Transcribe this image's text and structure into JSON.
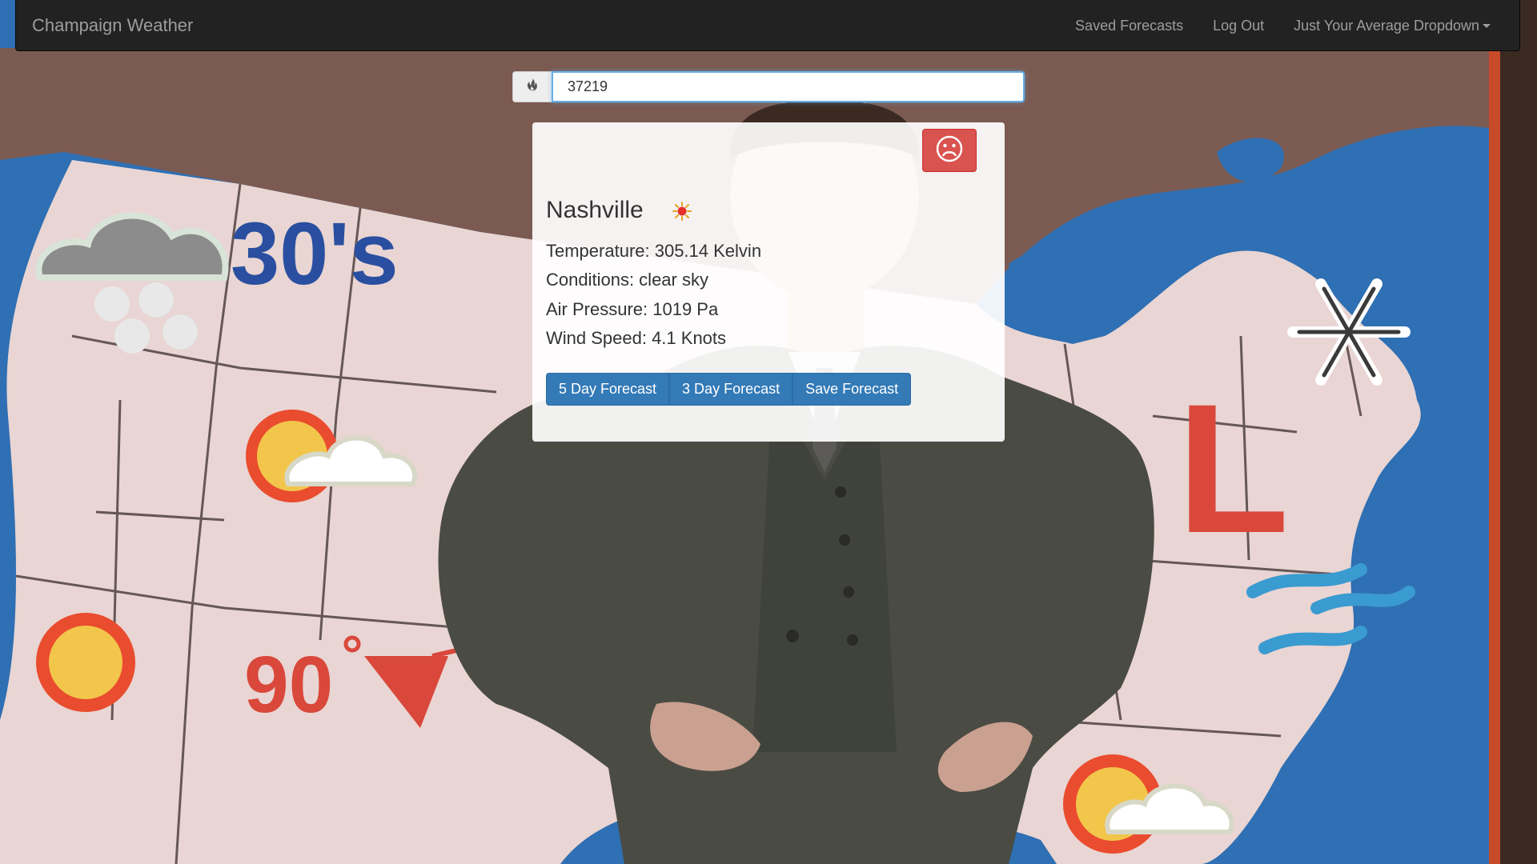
{
  "navbar": {
    "brand": "Champaign Weather",
    "links": [
      {
        "label": "Saved Forecasts"
      },
      {
        "label": "Log Out"
      },
      {
        "label": "Just Your Average Dropdown"
      }
    ]
  },
  "search": {
    "value": "37219",
    "addon_icon": "fire-icon"
  },
  "weather": {
    "city": "Nashville",
    "condition_icon": "sun-icon",
    "temperature": "Temperature: 305.14 Kelvin",
    "conditions": "Conditions: clear sky",
    "pressure": "Air Pressure: 1019 Pa",
    "wind": "Wind Speed: 4.1 Knots",
    "dislike_icon": "sad-face-icon"
  },
  "actions": {
    "five_day": "5 Day Forecast",
    "three_day": "3 Day Forecast",
    "save": "Save Forecast"
  },
  "background": {
    "map_labels": [
      "30's",
      "90°",
      "L"
    ]
  },
  "colors": {
    "navbar": "#222222",
    "primary": "#337ab7",
    "danger": "#d9534f",
    "ocean": "#2f6fb3",
    "land": "#e9d5d3",
    "canada": "#7b5a52",
    "map_label_blue": "#2a4fa0",
    "map_label_red": "#d9483b"
  }
}
